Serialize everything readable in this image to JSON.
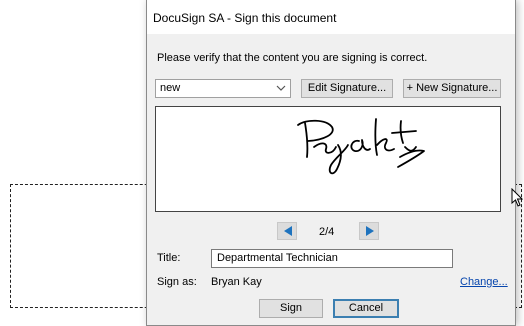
{
  "dialog": {
    "title": "DocuSign SA - Sign this document",
    "prompt": "Please verify that the content you are signing is correct.",
    "signature_select": {
      "value": "new"
    },
    "edit_signature_label": "Edit Signature...",
    "new_signature_label": "+ New Signature...",
    "pager": {
      "current": 2,
      "total": 4,
      "text": "2/4"
    },
    "title_field": {
      "label": "Title:",
      "value": "Departmental Technician"
    },
    "sign_as": {
      "label": "Sign as:",
      "value": "Bryan Kay",
      "change_link": "Change..."
    },
    "sign_label": "Sign",
    "cancel_label": "Cancel"
  },
  "colors": {
    "accent": "#3c7fb1",
    "arrow": "#1e73be",
    "link": "#0645ad"
  },
  "icons": [
    "chevron-down-icon",
    "arrow-left-icon",
    "arrow-right-icon",
    "mouse-cursor-icon"
  ]
}
